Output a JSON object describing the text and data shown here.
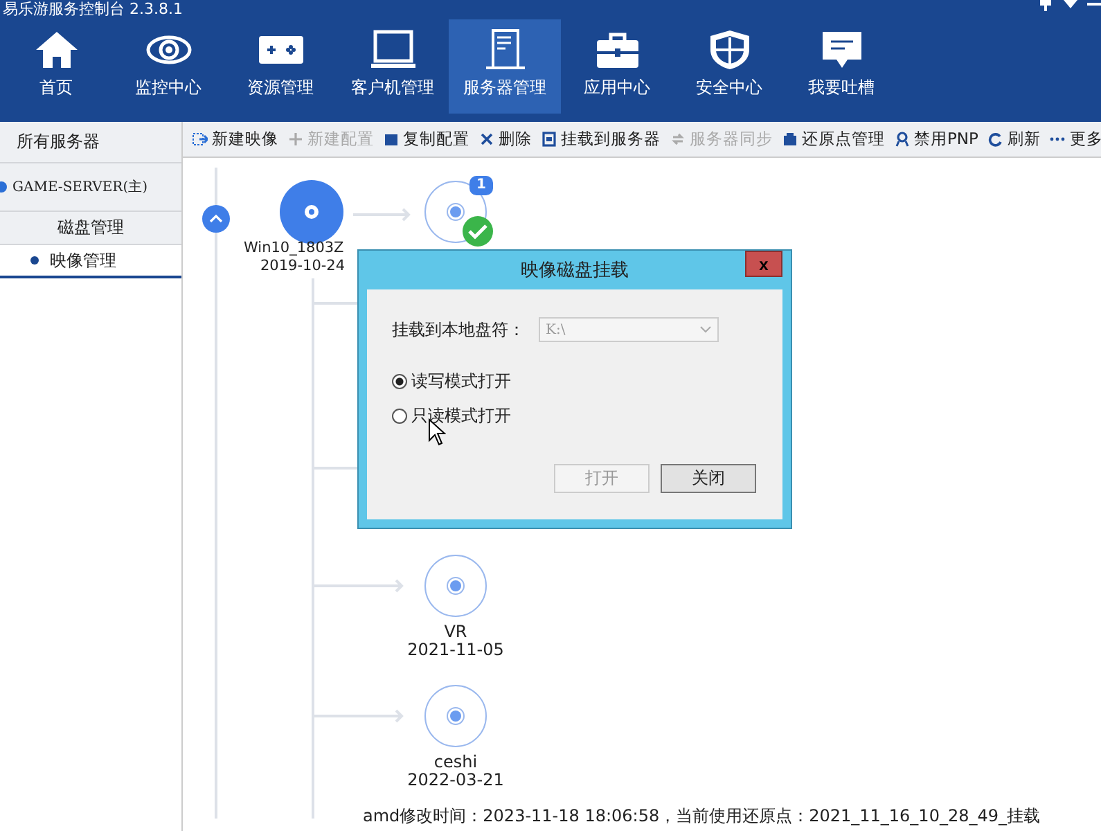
{
  "window": {
    "title": "易乐游服务控制台 2.3.8.1"
  },
  "nav": [
    {
      "label": "首页",
      "selected": false
    },
    {
      "label": "监控中心",
      "selected": false
    },
    {
      "label": "资源管理",
      "selected": false
    },
    {
      "label": "客户机管理",
      "selected": false
    },
    {
      "label": "服务器管理",
      "selected": true
    },
    {
      "label": "应用中心",
      "selected": false
    },
    {
      "label": "安全中心",
      "selected": false
    },
    {
      "label": "我要吐槽",
      "selected": false
    }
  ],
  "sidebar": {
    "header": "所有服务器",
    "server": {
      "label": "GAME-SERVER(主)"
    },
    "group": "磁盘管理",
    "items": [
      {
        "label": "映像管理",
        "selected": true
      }
    ]
  },
  "toolbar": [
    {
      "label": "新建映像",
      "disabled": false
    },
    {
      "label": "新建配置",
      "disabled": true
    },
    {
      "label": "复制配置",
      "disabled": false
    },
    {
      "label": "删除",
      "disabled": false
    },
    {
      "label": "挂载到服务器",
      "disabled": false
    },
    {
      "label": "服务器同步",
      "disabled": true
    },
    {
      "label": "还原点管理",
      "disabled": false
    },
    {
      "label": "禁用PNP",
      "disabled": false
    },
    {
      "label": "刷新",
      "disabled": false
    },
    {
      "label": "更多",
      "disabled": false
    }
  ],
  "tree": {
    "root": {
      "name": "Win10_1803Z",
      "date": "2019-10-24",
      "expanded": true
    },
    "first": {
      "badge": "1",
      "mounted": true
    },
    "children": [
      {
        "name": "VR",
        "date": "2021-11-05"
      },
      {
        "name": "ceshi",
        "date": "2022-03-21"
      }
    ]
  },
  "dialog": {
    "title": "映像磁盘挂载",
    "close": "x",
    "drive_label": "挂载到本地盘符：",
    "drive_value": "K:\\",
    "drive_disabled": true,
    "options": [
      {
        "label": "读写模式打开",
        "selected": true
      },
      {
        "label": "只读模式打开",
        "selected": false
      }
    ],
    "buttons": [
      {
        "label": "打开",
        "disabled": true
      },
      {
        "label": "关闭",
        "disabled": false
      }
    ]
  },
  "status_bar": "amd修改时间：2023-11-18 18:06:58，当前使用还原点：2021_11_16_10_28_49_挂载"
}
